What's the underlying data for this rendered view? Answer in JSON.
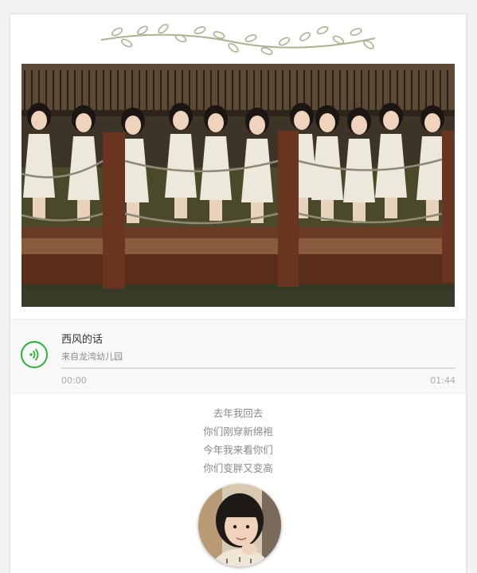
{
  "article": {
    "decoration": "leaf-vine-divider",
    "photo_alt": "",
    "audio": {
      "title": "西风的话",
      "source": "来自龙湾幼儿园",
      "current_time": "00:00",
      "duration": "01:44",
      "progress": 0,
      "accent_color": "#2bb335",
      "icon": "audio-wave-icon"
    },
    "poem_lines": [
      "去年我回去",
      "你们刚穿新绵袍",
      "今年我来看你们",
      "你们变胖又变高"
    ]
  }
}
